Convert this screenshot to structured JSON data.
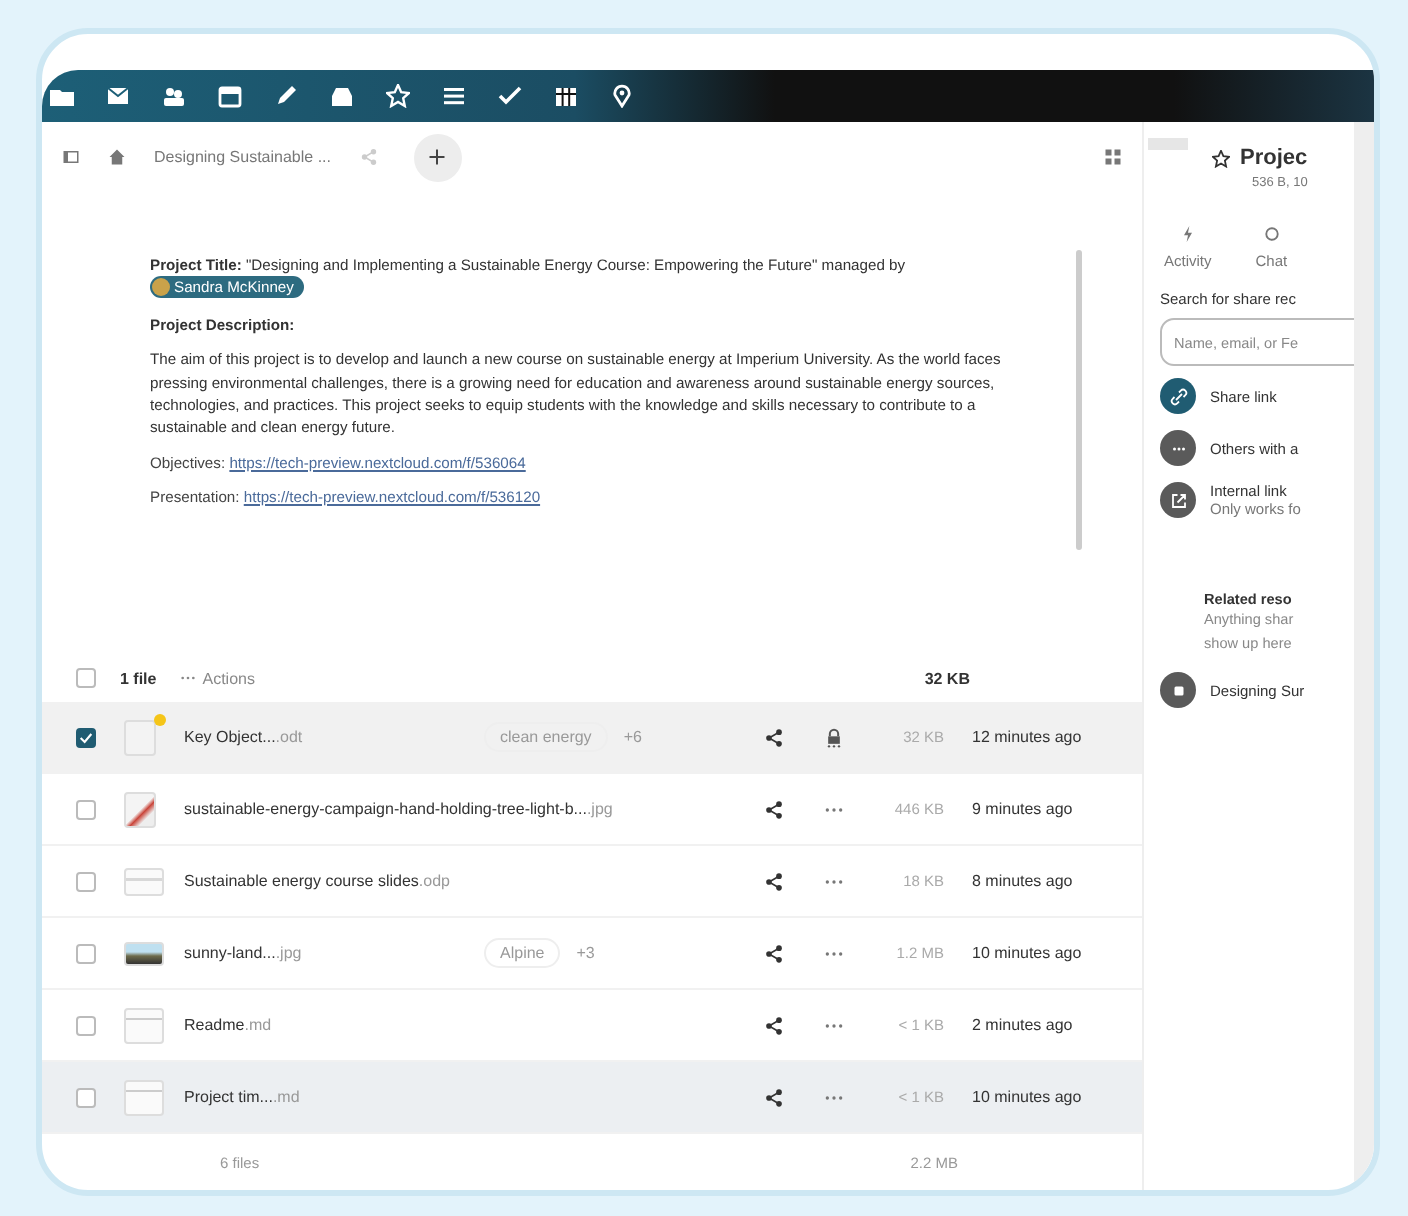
{
  "breadcrumb": {
    "folder": "Designing Sustainable ..."
  },
  "description": {
    "title_label": "Project Title:",
    "title_text": "\"Designing and Implementing a Sustainable Energy Course: Empowering the Future\" managed by",
    "manager": "Sandra McKinney",
    "heading": "Project Description:",
    "paragraph": "The aim of this project is to develop and launch a new course on sustainable energy at Imperium University. As the world faces pressing environmental challenges, there is a growing need for education and awareness around sustainable energy sources, technologies, and practices. This project seeks to equip students with the knowledge and skills necessary to contribute to a sustainable and clean energy future.",
    "links": [
      {
        "label": "Objectives:",
        "url": "https://tech-preview.nextcloud.com/f/536064"
      },
      {
        "label": "Presentation:",
        "url": "https://tech-preview.nextcloud.com/f/536120"
      }
    ]
  },
  "file_list": {
    "checked": false,
    "selected_count": "1 file",
    "actions": "Actions",
    "total_size": "32 KB"
  },
  "files": [
    {
      "name": "Key Object...",
      "ext": ".odt",
      "kind": "document",
      "favorite": true,
      "tag": "clean energy",
      "more_tags": "+6",
      "locked": true,
      "size": "32 KB",
      "modified": "12 minutes ago",
      "selected": true,
      "hovered": false
    },
    {
      "name": "sustainable-energy-campaign-hand-holding-tree-light-b...",
      "ext": ".jpg",
      "kind": "photo",
      "favorite": false,
      "locked": false,
      "size": "446 KB",
      "modified": "9 minutes ago",
      "selected": false,
      "hovered": false
    },
    {
      "name": "Sustainable energy course slides",
      "ext": ".odp",
      "kind": "slides",
      "favorite": false,
      "locked": false,
      "size": "18 KB",
      "modified": "8 minutes ago",
      "selected": false,
      "hovered": false
    },
    {
      "name": "sunny-land...",
      "ext": ".jpg",
      "kind": "landscape",
      "favorite": false,
      "tag": "Alpine",
      "more_tags": "+3",
      "locked": false,
      "size": "1.2 MB",
      "modified": "10 minutes ago",
      "selected": false,
      "hovered": false
    },
    {
      "name": "Readme",
      "ext": ".md",
      "kind": "text",
      "favorite": false,
      "locked": false,
      "size": "< 1 KB",
      "modified": "2 minutes ago",
      "selected": false,
      "hovered": false
    },
    {
      "name": "Project tim...",
      "ext": ".md",
      "kind": "text",
      "favorite": false,
      "locked": false,
      "size": "< 1 KB",
      "modified": "10 minutes ago",
      "selected": false,
      "hovered": true
    }
  ],
  "footer": {
    "count": "6 files",
    "size": "2.2 MB"
  },
  "sidebar": {
    "title": "Projec",
    "meta": "536 B, 10",
    "tabs": [
      {
        "label": "Activity",
        "kind": "activity",
        "selected": false
      },
      {
        "label": "Chat",
        "kind": "chat",
        "selected": false
      }
    ],
    "search_label": "Search for share rec",
    "search_placeholder": "Name, email, or Fe",
    "shares": [
      {
        "kind": "link",
        "title": "Share link"
      },
      {
        "kind": "others",
        "title": "Others with a"
      },
      {
        "kind": "internal",
        "title": "Internal link",
        "subtitle": "Only works fo"
      }
    ],
    "related_heading": "Related reso",
    "related_text": [
      "Anything shar",
      "show up here"
    ],
    "related_items": [
      {
        "title": "Designing Sur"
      }
    ]
  }
}
